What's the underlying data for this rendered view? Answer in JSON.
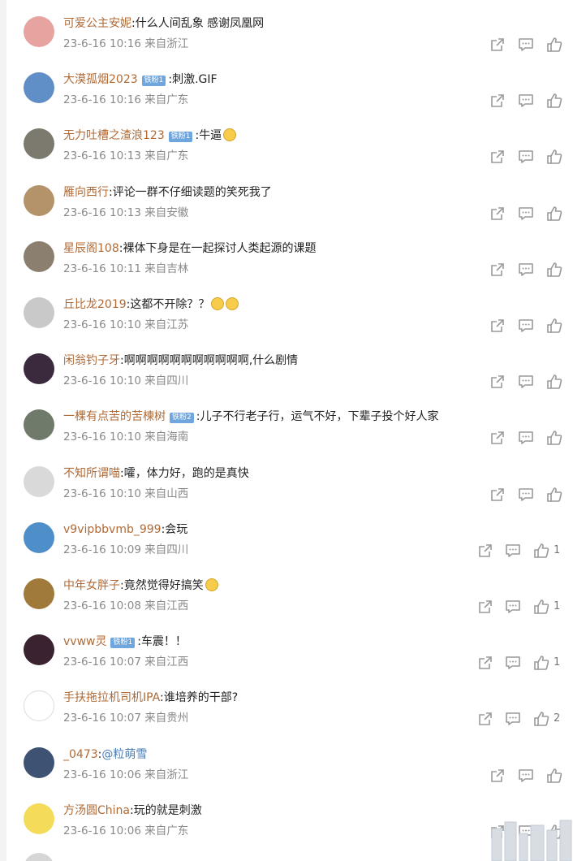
{
  "comments": [
    {
      "name": "可爱公主安妮",
      "badge": "",
      "text": "什么人间乱象 感谢凤凰网",
      "emojis": 0,
      "date": "23-6-16",
      "time": "10:16",
      "location": "来自浙江",
      "likes": "",
      "avatar_color": "#e7a3a0"
    },
    {
      "name": "大漠孤烟2023",
      "badge": "铁粉1",
      "text": "刺激.GIF",
      "emojis": 0,
      "date": "23-6-16",
      "time": "10:16",
      "location": "来自广东",
      "likes": "",
      "avatar_color": "#5f8fc6"
    },
    {
      "name": "无力吐槽之渣浪123",
      "badge": "铁粉1",
      "text": "牛逼",
      "emojis": 1,
      "date": "23-6-16",
      "time": "10:13",
      "location": "来自广东",
      "likes": "",
      "avatar_color": "#7c7a6e"
    },
    {
      "name": "雁向西行",
      "badge": "",
      "text": "评论一群不仔细读题的笑死我了",
      "emojis": 0,
      "date": "23-6-16",
      "time": "10:13",
      "location": "来自安徽",
      "likes": "",
      "avatar_color": "#b5936a"
    },
    {
      "name": "星辰阁108",
      "badge": "",
      "text": "裸体下身是在一起探讨人类起源的课题",
      "emojis": 0,
      "date": "23-6-16",
      "time": "10:11",
      "location": "来自吉林",
      "likes": "",
      "avatar_color": "#8b7f70"
    },
    {
      "name": "丘比龙2019",
      "badge": "",
      "text": "这都不开除？？",
      "emojis": 2,
      "date": "23-6-16",
      "time": "10:10",
      "location": "来自江苏",
      "likes": "",
      "avatar_color": "#c9c9c9"
    },
    {
      "name": "闲翁钓子牙",
      "badge": "",
      "text": "啊啊啊啊啊啊啊啊啊啊啊,什么剧情",
      "emojis": 0,
      "date": "23-6-16",
      "time": "10:10",
      "location": "来自四川",
      "likes": "",
      "avatar_color": "#3b2a3e"
    },
    {
      "name": "一棵有点苦的苦楝树",
      "badge": "铁粉2",
      "text": "儿子不行老子行，运气不好，下辈子投个好人家",
      "emojis": 0,
      "date": "23-6-16",
      "time": "10:10",
      "location": "来自海南",
      "likes": "",
      "avatar_color": "#6f7a6a"
    },
    {
      "name": "不知所谓喵",
      "badge": "",
      "text": "嚯，体力好，跑的是真快",
      "emojis": 0,
      "date": "23-6-16",
      "time": "10:10",
      "location": "来自山西",
      "likes": "",
      "avatar_color": "#d9d9d9"
    },
    {
      "name": "v9vipbbvmb_999",
      "badge": "",
      "text": "会玩",
      "emojis": 0,
      "date": "23-6-16",
      "time": "10:09",
      "location": "来自四川",
      "likes": "1",
      "avatar_color": "#4f8fc9"
    },
    {
      "name": "中年女胖子",
      "badge": "",
      "text": "竟然觉得好搞笑",
      "emojis": 1,
      "date": "23-6-16",
      "time": "10:08",
      "location": "来自江西",
      "likes": "1",
      "avatar_color": "#a07a3a"
    },
    {
      "name": "vvww灵",
      "badge": "铁粉1",
      "text": "车震！！",
      "emojis": 0,
      "date": "23-6-16",
      "time": "10:07",
      "location": "来自江西",
      "likes": "1",
      "avatar_color": "#3a2230"
    },
    {
      "name": "手扶拖拉机司机IPA",
      "badge": "",
      "text": "谁培养的干部?",
      "emojis": 0,
      "date": "23-6-16",
      "time": "10:07",
      "location": "来自贵州",
      "likes": "2",
      "avatar_color": "#ffffff"
    },
    {
      "name": "_0473",
      "badge": "",
      "text": "",
      "mention": "@粒萌雪",
      "emojis": 0,
      "date": "23-6-16",
      "time": "10:06",
      "location": "来自浙江",
      "likes": "",
      "avatar_color": "#3e5274"
    },
    {
      "name": "方汤圆China",
      "badge": "",
      "text": "玩的就是刺激",
      "emojis": 0,
      "date": "23-6-16",
      "time": "10:06",
      "location": "来自广东",
      "likes": "",
      "avatar_color": "#f4dc5a"
    }
  ],
  "icons": {
    "repost": "share-icon",
    "comment": "comment-icon",
    "like": "thumbs-up-icon"
  },
  "colors": {
    "username": "#b06a36",
    "meta": "#8a8a8a",
    "badge": "#6fa6dd",
    "mention": "#4a7cb3",
    "icon": "#9a9a9a"
  }
}
